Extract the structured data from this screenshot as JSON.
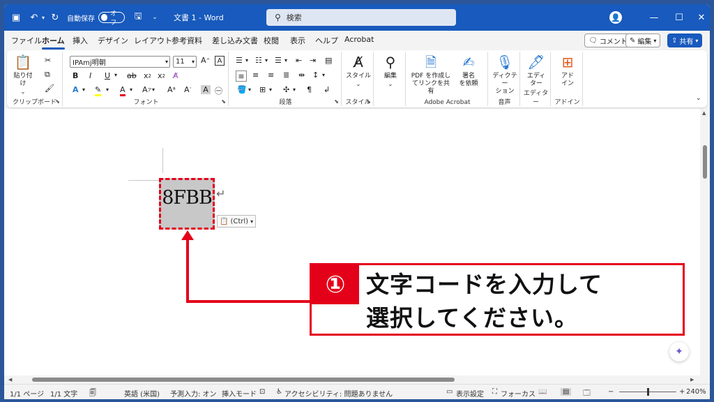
{
  "titlebar": {
    "autosave_label": "自動保存",
    "autosave_state": "オフ",
    "doc_title": "文書 1  -  Word",
    "search_placeholder": "検索"
  },
  "menu": {
    "tabs": [
      "ファイル",
      "ホーム",
      "挿入",
      "デザイン",
      "レイアウト",
      "参考資料",
      "差し込み文書",
      "校閲",
      "表示",
      "ヘルプ",
      "Acrobat"
    ],
    "active_tab": "ホーム",
    "comment_label": "コメント",
    "edit_label": "編集",
    "share_label": "共有"
  },
  "ribbon": {
    "clipboard": {
      "paste_label": "貼り付け",
      "group_label": "クリップボード"
    },
    "font": {
      "font_name": "IPAmj明朝",
      "font_size": "11",
      "group_label": "フォント"
    },
    "paragraph": {
      "group_label": "段落"
    },
    "styles": {
      "button_label": "スタイル",
      "group_label": "スタイル"
    },
    "editing": {
      "button_label": "編集"
    },
    "acrobat": {
      "pdf_share_label": "PDF を作成し\nてリンクを共有",
      "sign_label": "署名\nを依頼",
      "group_label": "Adobe Acrobat"
    },
    "voice": {
      "dictate_label": "ディクテー\nション",
      "group_label": "音声"
    },
    "editor": {
      "button_label": "エディ\nター",
      "group_label": "エディター"
    },
    "addins": {
      "button_label": "アド\nイン",
      "group_label": "アドイン"
    }
  },
  "document": {
    "selected_text": "8FBB",
    "paste_options_label": "(Ctrl)"
  },
  "callout": {
    "number": "①",
    "line1": "文字コードを入力して",
    "line2": "選択してください。"
  },
  "status": {
    "page": "1/1 ページ",
    "words": "1/1 文字",
    "language": "英語 (米国)",
    "predictive": "予測入力: オン",
    "insert_mode": "挿入モード",
    "accessibility": "アクセシビリティ: 問題ありません",
    "display_settings": "表示設定",
    "focus": "フォーカス",
    "zoom": "240%"
  },
  "colors": {
    "title_blue": "#185abd",
    "callout_red": "#e5001a"
  }
}
